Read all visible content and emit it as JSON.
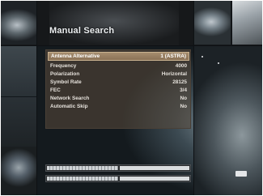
{
  "screen": {
    "title": "Manual Search"
  },
  "menu": {
    "rows": [
      {
        "label": "Antenna Alternative",
        "value": "1 (ASTRA)"
      },
      {
        "label": "Frequency",
        "value": "4000"
      },
      {
        "label": "Polarization",
        "value": "Horizontal"
      },
      {
        "label": "Symbol Rate",
        "value": "28125"
      },
      {
        "label": "FEC",
        "value": "3/4"
      },
      {
        "label": "Network Search",
        "value": "No"
      },
      {
        "label": "Automatic Skip",
        "value": "No"
      }
    ],
    "selected_index": 0
  },
  "signal": {
    "level_fraction": 0.5,
    "quality_fraction": 0.5
  },
  "colors": {
    "selected_row": "#9a8064",
    "menu_panel": "#5a4a3c"
  }
}
